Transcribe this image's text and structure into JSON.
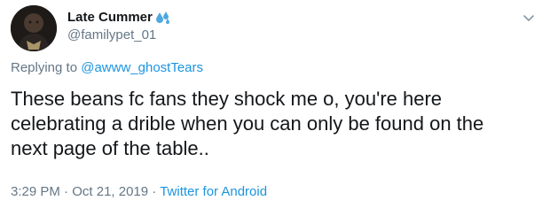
{
  "tweet": {
    "author": {
      "display_name": "Late Cummer",
      "handle": "@familypet_01",
      "name_emoji": "sweat-droplets-icon"
    },
    "replying_to": {
      "prefix": "Replying to ",
      "mention": "@awww_ghostTears"
    },
    "text": "These beans fc fans they shock me o, you're here\ncelebrating a drible when you can only be found on the\nnext page of the table..",
    "time": "3:29 PM",
    "separator1": " · ",
    "date": "Oct 21, 2019",
    "separator2": " · ",
    "source": "Twitter for Android"
  },
  "colors": {
    "text_primary": "#14171a",
    "text_secondary": "#657786",
    "link": "#1b95e0",
    "emoji_blue": "#4fa8e0"
  }
}
